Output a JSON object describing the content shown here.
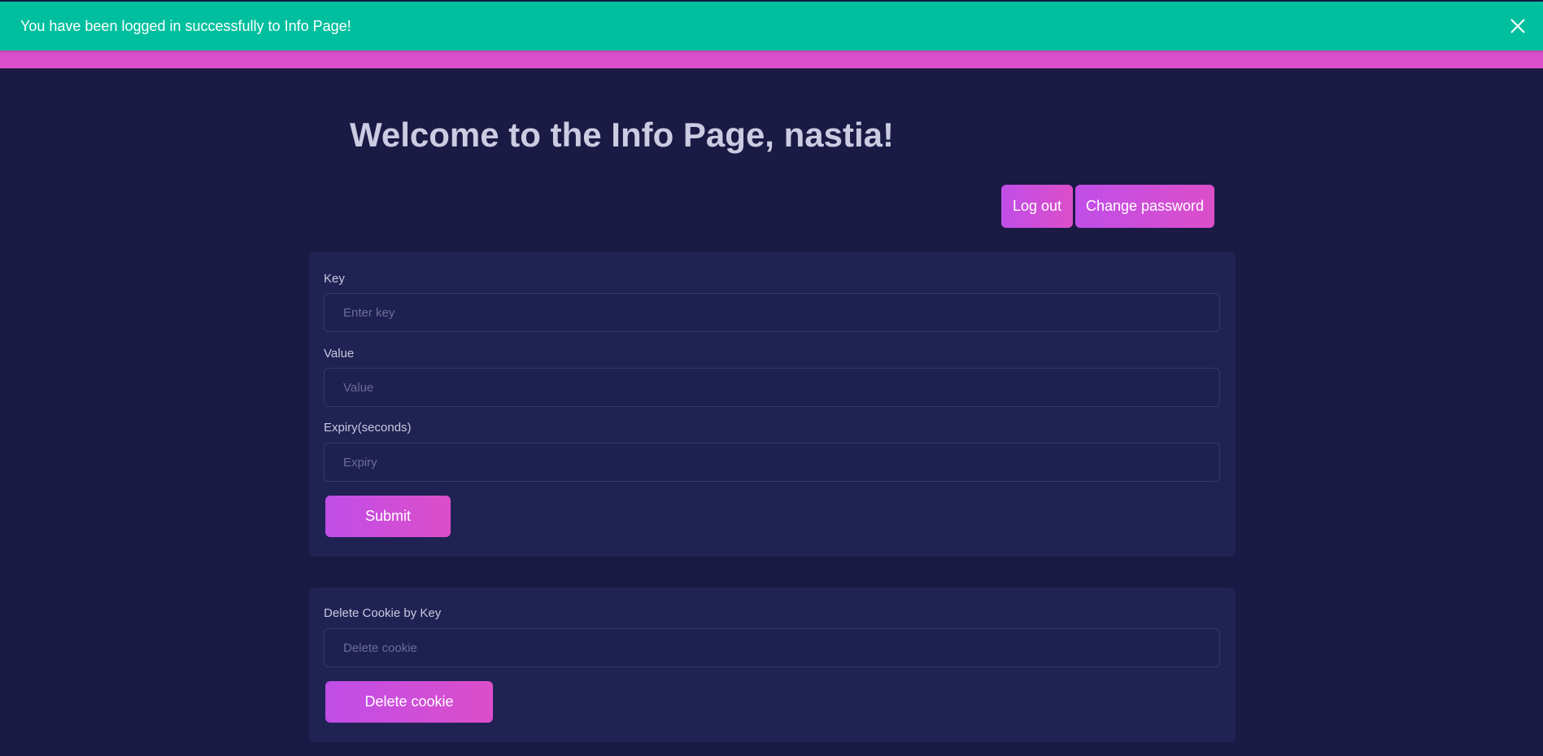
{
  "toast": {
    "message": "You have been logged in successfully to Info Page!",
    "close_icon": "close-icon"
  },
  "header": {
    "title": "Welcome to the Info Page, nastia!",
    "logout_label": "Log out",
    "change_password_label": "Change password"
  },
  "cookie_form": {
    "key_label": "Key",
    "key_placeholder": "Enter key",
    "key_value": "",
    "value_label": "Value",
    "value_placeholder": "Value",
    "value_value": "",
    "expiry_label": "Expiry(seconds)",
    "expiry_placeholder": "Expiry",
    "expiry_value": "",
    "submit_label": "Submit"
  },
  "delete_form": {
    "label": "Delete Cookie by Key",
    "placeholder": "Delete cookie",
    "value": "",
    "button_label": "Delete cookie"
  },
  "colors": {
    "background": "#1a1a44",
    "card": "#212254",
    "toast": "#00bf9e",
    "accent_bar": "#db4fcd",
    "button_gradient_start": "#c04ee8",
    "button_gradient_end": "#dc4ec9"
  }
}
